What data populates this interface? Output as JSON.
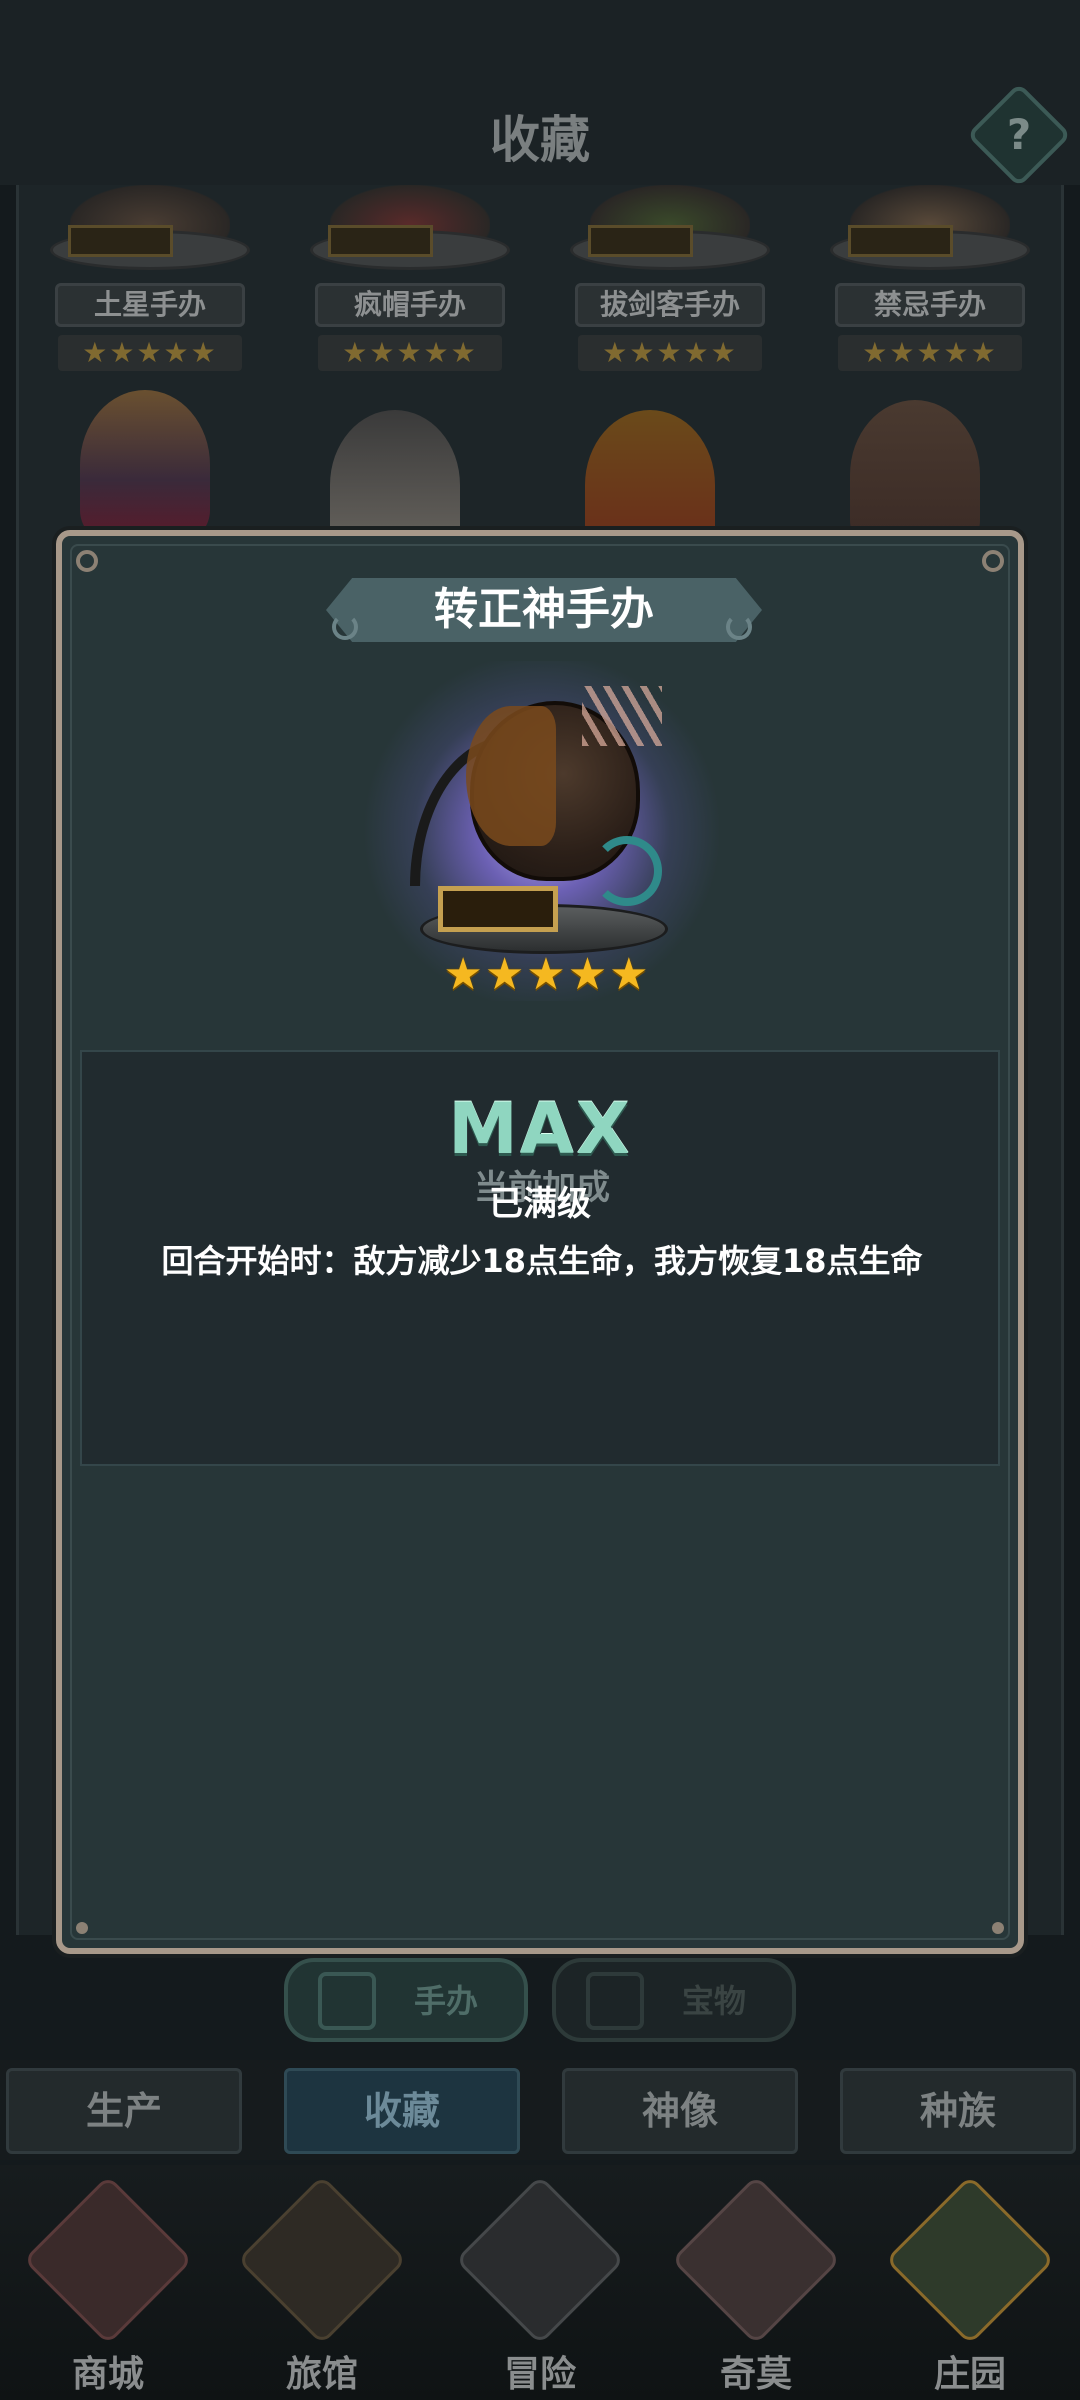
{
  "header": {
    "title": "收藏",
    "help_label": "?"
  },
  "collection_cards": [
    {
      "name": "土星手办",
      "stars": "★★★★★"
    },
    {
      "name": "疯帽手办",
      "stars": "★★★★★"
    },
    {
      "name": "拔剑客手办",
      "stars": "★★★★★"
    },
    {
      "name": "禁忌手办",
      "stars": "★★★★★"
    }
  ],
  "sub_tabs": [
    {
      "label": "手办",
      "active": true
    },
    {
      "label": "宝物",
      "active": false
    }
  ],
  "categories": [
    {
      "label": "生产"
    },
    {
      "label": "收藏"
    },
    {
      "label": "神像"
    },
    {
      "label": "种族"
    }
  ],
  "bottom_nav": [
    {
      "label": "商城",
      "icon": "shop-icon"
    },
    {
      "label": "旅馆",
      "icon": "inn-gate-icon"
    },
    {
      "label": "冒险",
      "icon": "crossed-swords-icon"
    },
    {
      "label": "奇莫",
      "icon": "chimo-character-icon"
    },
    {
      "label": "庄园",
      "icon": "manor-island-icon"
    }
  ],
  "modal": {
    "title": "转正神手办",
    "stars": "★★★★★",
    "bonus_title": "当前加成",
    "bonus_desc": "回合开始时：敌方减少18点生命，我方恢复18点生命",
    "max_label": "MAX",
    "max_sub": "已满级"
  },
  "colors": {
    "star": "#f5b820",
    "max_text": "#8fd6c0",
    "modal_bg": "#273638",
    "modal_border": "#a8998a"
  }
}
